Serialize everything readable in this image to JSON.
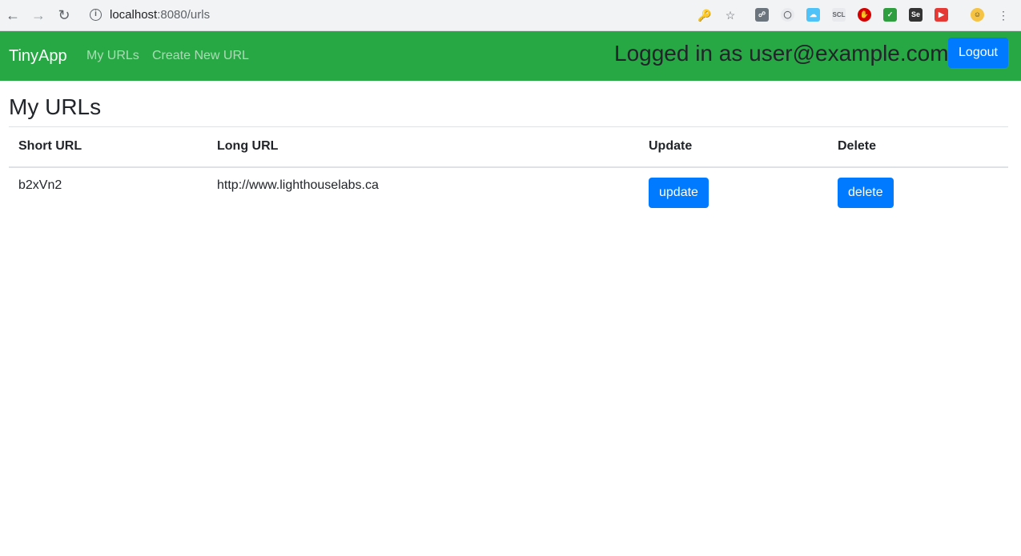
{
  "browser": {
    "url_host": "localhost",
    "url_path": ":8080/urls",
    "icons": [
      "back-icon",
      "forward-icon",
      "reload-icon",
      "info-icon",
      "key-icon",
      "star-icon",
      "profile-icon"
    ],
    "ext_labels": {
      "scl": "SCL",
      "se": "Se"
    }
  },
  "navbar": {
    "brand": "TinyApp",
    "links": [
      "My URLs",
      "Create New URL"
    ],
    "logged_in_text": "Logged in as user@example.com",
    "logout_label": "Logout",
    "color": "#28a745"
  },
  "main": {
    "title": "My URLs",
    "table": {
      "headers": [
        "Short URL",
        "Long URL",
        "Update",
        "Delete"
      ],
      "rows": [
        {
          "short_url": "b2xVn2",
          "long_url": "http://www.lighthouselabs.ca",
          "update_label": "update",
          "delete_label": "delete"
        }
      ]
    }
  },
  "colors": {
    "primary": "#007bff"
  }
}
